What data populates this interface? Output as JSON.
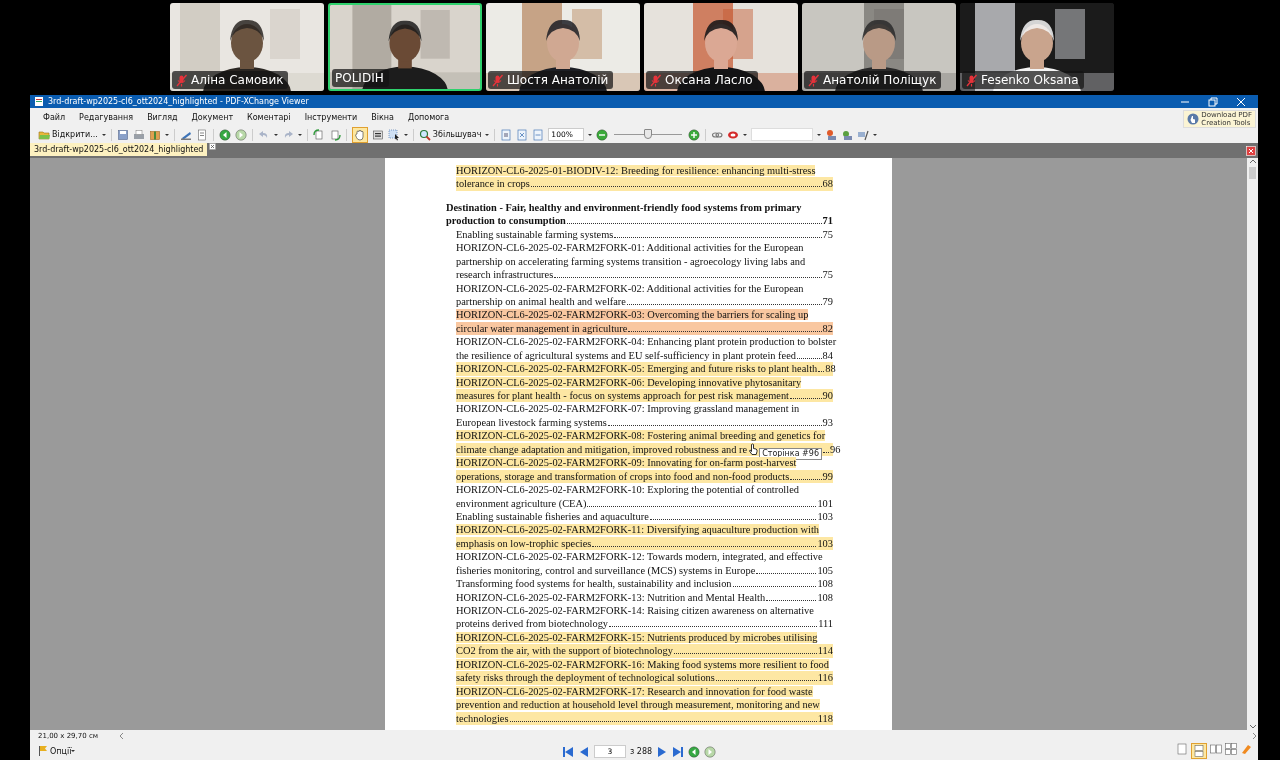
{
  "participants": [
    {
      "name": "Аліна Самовик",
      "muted": true,
      "speaking": false
    },
    {
      "name": "POLIDIH",
      "muted": false,
      "speaking": true
    },
    {
      "name": "Шостя Анатолій",
      "muted": true,
      "speaking": false
    },
    {
      "name": "Оксана Ласло",
      "muted": true,
      "speaking": false
    },
    {
      "name": "Анатолій Поліщук",
      "muted": true,
      "speaking": false
    },
    {
      "name": "Fesenko Oksana",
      "muted": true,
      "speaking": false
    }
  ],
  "window": {
    "title": "3rd-draft-wp2025-cl6_ott2024_highlighted - PDF-XChange Viewer"
  },
  "menu": [
    "Файл",
    "Редагування",
    "Вигляд",
    "Документ",
    "Коментарі",
    "Інструменти",
    "Вікна",
    "Допомога"
  ],
  "toolbar": {
    "open_label": "Відкрити...",
    "zoom_tool_label": "Збільшувач",
    "zoom_value": "100%",
    "zoom_slider": {
      "level": 0.5
    },
    "promo": [
      "Download PDF",
      "Creation Tools"
    ]
  },
  "tabs": [
    {
      "label": "3rd-draft-wp2025-cl6_ott2024_highlighted",
      "selected": true
    }
  ],
  "document": {
    "entries": [
      {
        "kind": "item",
        "color": "#fde7a3",
        "lines": [
          "HORIZON-CL6-2025-01-BIODIV-12: Breeding for resilience: enhancing multi-stress",
          "tolerance in crops"
        ],
        "page": "68"
      },
      {
        "kind": "heading",
        "lines": [
          "Destination - Fair, healthy and environment-friendly food systems from primary",
          "production to consumption"
        ],
        "page": "71"
      },
      {
        "kind": "item",
        "lines": [
          "Enabling sustainable farming systems"
        ],
        "page": "75"
      },
      {
        "kind": "item",
        "lines": [
          "HORIZON-CL6-2025-02-FARM2FORK-01: Additional activities for the European",
          "partnership on accelerating farming systems transition - agroecology living labs and",
          "research infrastructures"
        ],
        "page": "75"
      },
      {
        "kind": "item",
        "lines": [
          "HORIZON-CL6-2025-02-FARM2FORK-02: Additional activities for the European",
          "partnership on animal health and welfare"
        ],
        "page": "79"
      },
      {
        "kind": "item",
        "color": "#f9c7a0",
        "lines": [
          "HORIZON-CL6-2025-02-FARM2FORK-03: Overcoming the barriers for scaling up",
          "circular water management in agriculture"
        ],
        "page": "82"
      },
      {
        "kind": "item",
        "lines": [
          "HORIZON-CL6-2025-02-FARM2FORK-04: Enhancing plant protein production to bolster",
          "the resilience of agricultural systems and EU self-sufficiency in plant protein feed"
        ],
        "page": "84"
      },
      {
        "kind": "item",
        "color": "#fde7a3",
        "lines": [
          "HORIZON-CL6-2025-02-FARM2FORK-05: Emerging and future risks to plant health"
        ],
        "page": "88"
      },
      {
        "kind": "item",
        "color": "#fde7a3",
        "lines": [
          "HORIZON-CL6-2025-02-FARM2FORK-06: Developing innovative phytosanitary",
          "measures for plant health - focus on systems approach for pest risk management"
        ],
        "page": "90"
      },
      {
        "kind": "item",
        "lines": [
          "HORIZON-CL6-2025-02-FARM2FORK-07: Improving grassland management in",
          "European livestock farming systems"
        ],
        "page": "93"
      },
      {
        "kind": "item",
        "color": "#fde7a3",
        "lines": [
          "HORIZON-CL6-2025-02-FARM2FORK-08: Fostering animal breeding and genetics for",
          "climate change adaptation and mitigation, improved robustness and re"
        ],
        "page": "96",
        "tooltip": "Сторінка #96"
      },
      {
        "kind": "item",
        "color": "#fde7a3",
        "lines": [
          "HORIZON-CL6-2025-02-FARM2FORK-09: Innovating for on-farm post-harvest",
          "operations, storage and transformation of crops into food and non-food products"
        ],
        "page": "99"
      },
      {
        "kind": "item",
        "lines": [
          "HORIZON-CL6-2025-02-FARM2FORK-10: Exploring the potential of controlled",
          "environment agriculture (CEA)"
        ],
        "page": "101"
      },
      {
        "kind": "item",
        "lines": [
          "Enabling sustainable fisheries and aquaculture"
        ],
        "page": "103"
      },
      {
        "kind": "item",
        "color": "#fde7a3",
        "lines": [
          "HORIZON-CL6-2025-02-FARM2FORK-11: Diversifying aquaculture production with",
          "emphasis on low-trophic species"
        ],
        "page": "103"
      },
      {
        "kind": "item",
        "lines": [
          "HORIZON-CL6-2025-02-FARM2FORK-12: Towards modern, integrated, and effective",
          "fisheries monitoring, control and surveillance (MCS) systems in Europe"
        ],
        "page": "105"
      },
      {
        "kind": "item",
        "lines": [
          "Transforming food systems for health, sustainability and inclusion"
        ],
        "page": "108"
      },
      {
        "kind": "item",
        "lines": [
          "HORIZON-CL6-2025-02-FARM2FORK-13: Nutrition and Mental Health"
        ],
        "page": "108"
      },
      {
        "kind": "item",
        "lines": [
          "HORIZON-CL6-2025-02-FARM2FORK-14: Raising citizen awareness on alternative",
          "proteins derived from biotechnology"
        ],
        "page": "111"
      },
      {
        "kind": "item",
        "color": "#fde7a3",
        "lines": [
          "HORIZON-CL6-2025-02-FARM2FORK-15: Nutrients produced by microbes utilising",
          "CO2 from the air, with the support of biotechnology"
        ],
        "page": "114"
      },
      {
        "kind": "item",
        "color": "#fde7a3",
        "lines": [
          "HORIZON-CL6-2025-02-FARM2FORK-16: Making food systems more resilient to food",
          "safety risks through the deployment of technological solutions"
        ],
        "page": "116"
      },
      {
        "kind": "item",
        "color": "#fde7a3",
        "lines": [
          "HORIZON-CL6-2025-02-FARM2FORK-17: Research and innovation for food waste",
          "prevention and reduction at household level through measurement, monitoring and new",
          "technologies"
        ],
        "page": "118"
      }
    ]
  },
  "status_bar": {
    "page_size": "21,00 x 29,70 см",
    "options_label": "Опції",
    "current_page": "3",
    "page_count": "з 288"
  }
}
